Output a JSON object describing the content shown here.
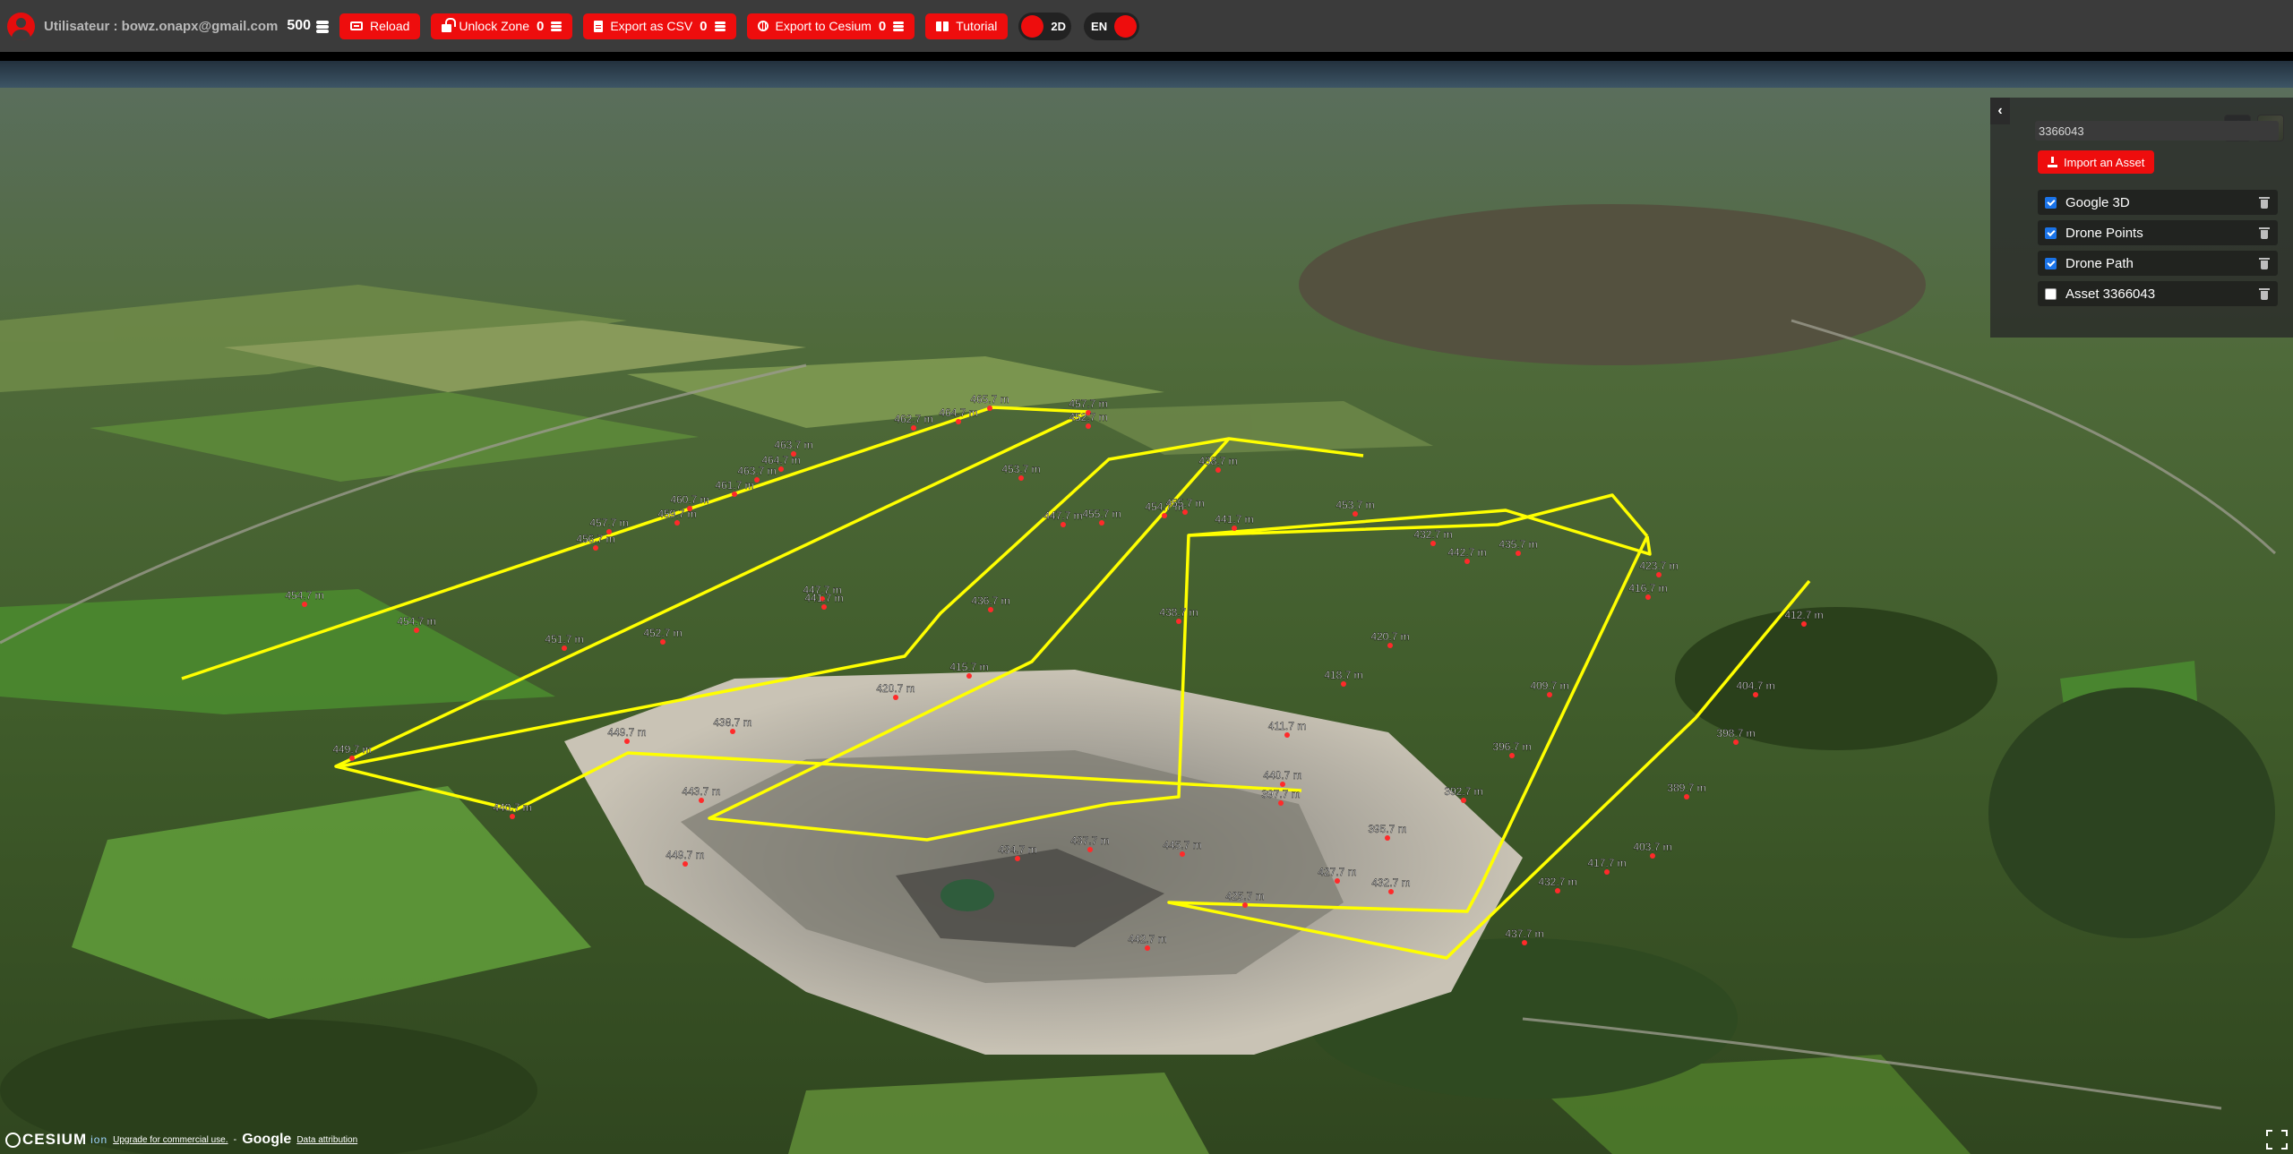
{
  "topbar": {
    "user_label": "Utilisateur : bowz.onapx@gmail.com",
    "credits": "500",
    "buttons": [
      {
        "label": "Reload",
        "icon": "reload-icon"
      },
      {
        "label": "Unlock Zone",
        "count": "0",
        "icon": "unlock-icon"
      },
      {
        "label": "Export as CSV",
        "count": "0",
        "icon": "file-icon"
      },
      {
        "label": "Export to Cesium",
        "count": "0",
        "icon": "globe-icon"
      },
      {
        "label": "Tutorial",
        "icon": "book-icon"
      }
    ],
    "mode_toggle_label": "2D",
    "lang_toggle_label": "EN",
    "accent_color": "#ee0d0d"
  },
  "panel": {
    "search_value": "3366043",
    "import_label": "Import an Asset",
    "layers": [
      {
        "label": "Google 3D",
        "checked": true
      },
      {
        "label": "Drone Points",
        "checked": true
      },
      {
        "label": "Drone Path",
        "checked": true
      },
      {
        "label": "Asset 3366043",
        "checked": false
      }
    ]
  },
  "map": {
    "path_color": "#ffff00",
    "point_color": "#ff2a2a",
    "altitude_labels": [
      "465.7 m",
      "457.7 m",
      "464.7 m",
      "462.7 m",
      "463.7 m",
      "464.7 m",
      "463.7 m",
      "461.7 m",
      "460.7 m",
      "459.7 m",
      "457.7 m",
      "456.7 m",
      "454.7 m",
      "454.7 m",
      "451.7 m",
      "452.7 m",
      "447.7 m",
      "441.7 m",
      "454.7 m",
      "455.7 m",
      "453.7 m",
      "449.7 m",
      "440.7 m",
      "438.7 m",
      "420.7 m",
      "415.7 m",
      "436.7 m",
      "452.7 m",
      "453.7 m",
      "455.7 m",
      "447.7 m",
      "438.7 m",
      "441.7 m",
      "438.7 m",
      "432.7 m",
      "420.7 m",
      "418.7 m",
      "442.7 m",
      "435.7 m",
      "423.7 m",
      "416.7 m",
      "412.7 m",
      "409.7 m",
      "404.7 m",
      "398.7 m",
      "396.7 m",
      "392.7 m",
      "389.7 m",
      "395.7 m",
      "403.7 m",
      "417.7 m",
      "432.7 m",
      "437.7 m",
      "442.7 m",
      "434.7 m",
      "437.7 m",
      "445.7 m",
      "427.7 m",
      "425.7 m",
      "432.7 m",
      "397.7 m",
      "411.7 m",
      "440.7 m",
      "449.7 m",
      "449.7 m",
      "443.7 m"
    ]
  },
  "footer": {
    "cesium_label": "CESIUM",
    "ion_label": "ion",
    "commercial_link": "Upgrade for commercial use.",
    "separator": "-",
    "google_label": "Google",
    "attribution_link": "Data attribution"
  }
}
